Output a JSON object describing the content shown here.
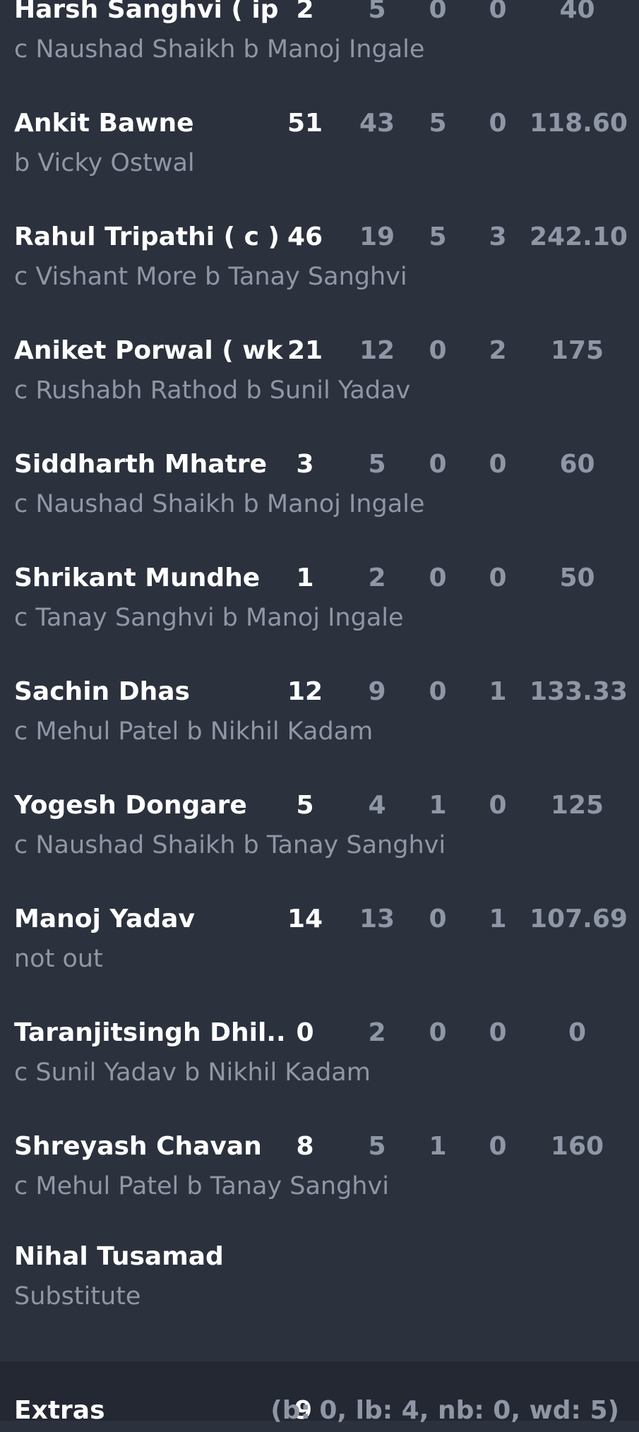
{
  "batting": [
    {
      "name": "Harsh Sanghvi ( ip )",
      "runs": "2",
      "balls": "5",
      "fours": "0",
      "sixes": "0",
      "sr": "40",
      "dismissal": "c Naushad Shaikh b Manoj Ingale"
    },
    {
      "name": "Ankit Bawne",
      "runs": "51",
      "balls": "43",
      "fours": "5",
      "sixes": "0",
      "sr": "118.60",
      "dismissal": "b Vicky Ostwal"
    },
    {
      "name": "Rahul Tripathi ( c )",
      "runs": "46",
      "balls": "19",
      "fours": "5",
      "sixes": "3",
      "sr": "242.10",
      "dismissal": "c Vishant More b Tanay Sanghvi"
    },
    {
      "name": "Aniket Porwal ( wk )",
      "runs": "21",
      "balls": "12",
      "fours": "0",
      "sixes": "2",
      "sr": "175",
      "dismissal": "c Rushabh Rathod b Sunil Yadav"
    },
    {
      "name": "Siddharth Mhatre",
      "runs": "3",
      "balls": "5",
      "fours": "0",
      "sixes": "0",
      "sr": "60",
      "dismissal": "c Naushad Shaikh b Manoj Ingale"
    },
    {
      "name": "Shrikant Mundhe",
      "runs": "1",
      "balls": "2",
      "fours": "0",
      "sixes": "0",
      "sr": "50",
      "dismissal": "c Tanay Sanghvi b Manoj Ingale"
    },
    {
      "name": "Sachin Dhas",
      "runs": "12",
      "balls": "9",
      "fours": "0",
      "sixes": "1",
      "sr": "133.33",
      "dismissal": "c Mehul Patel b Nikhil Kadam"
    },
    {
      "name": "Yogesh Dongare",
      "runs": "5",
      "balls": "4",
      "fours": "1",
      "sixes": "0",
      "sr": "125",
      "dismissal": "c Naushad Shaikh b Tanay Sanghvi"
    },
    {
      "name": "Manoj Yadav",
      "runs": "14",
      "balls": "13",
      "fours": "0",
      "sixes": "1",
      "sr": "107.69",
      "dismissal": "not out"
    },
    {
      "name": "Taranjitsingh Dhil...",
      "runs": "0",
      "balls": "2",
      "fours": "0",
      "sixes": "0",
      "sr": "0",
      "dismissal": "c Sunil Yadav b Nikhil Kadam"
    },
    {
      "name": "Shreyash Chavan",
      "runs": "8",
      "balls": "5",
      "fours": "1",
      "sixes": "0",
      "sr": "160",
      "dismissal": "c Mehul Patel b Tanay Sanghvi"
    },
    {
      "name": "Nihal Tusamad",
      "runs": "",
      "balls": "",
      "fours": "",
      "sixes": "",
      "sr": "",
      "dismissal": "Substitute"
    }
  ],
  "extras": {
    "label": "Extras",
    "total": "9",
    "detail": "(b: 0, lb: 4, nb: 0, wd: 5)"
  }
}
